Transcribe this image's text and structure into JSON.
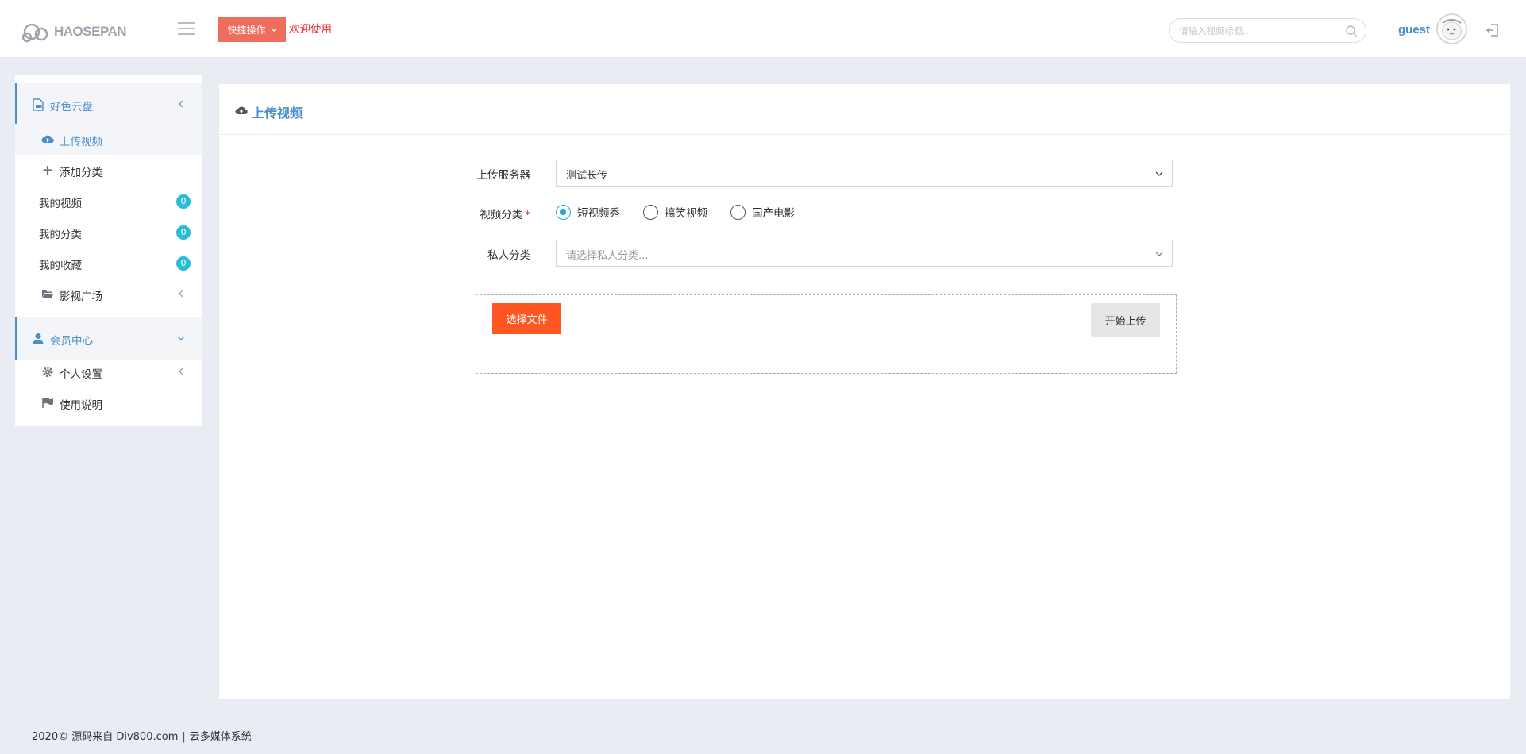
{
  "header": {
    "logo_text": "HAOSEPAN",
    "quick_action_label": "快捷操作",
    "welcome_text": "欢迎使用",
    "search_placeholder": "请输入视频标题...",
    "username": "guest"
  },
  "sidebar": {
    "group1": {
      "label": "好色云盘",
      "items": [
        {
          "label": "上传视频",
          "icon": "cloud-upload-icon"
        },
        {
          "label": "添加分类",
          "icon": "plus-icon"
        },
        {
          "label": "我的视频",
          "badge": "0"
        },
        {
          "label": "我的分类",
          "badge": "0"
        },
        {
          "label": "我的收藏",
          "badge": "0"
        },
        {
          "label": "影视广场",
          "icon": "folder-open-icon"
        }
      ]
    },
    "group2": {
      "label": "会员中心",
      "items": [
        {
          "label": "个人设置",
          "icon": "gear-icon"
        },
        {
          "label": "使用说明",
          "icon": "flag-icon"
        }
      ]
    }
  },
  "main": {
    "title": "上传视频",
    "form": {
      "server_label": "上传服务器",
      "server_value": "测试长传",
      "category_label": "视频分类",
      "category_required_mark": "*",
      "category_options": [
        "短视频秀",
        "搞笑视频",
        "国产电影"
      ],
      "category_selected": "短视频秀",
      "private_label": "私人分类",
      "private_placeholder": "请选择私人分类...",
      "pick_file_label": "选择文件",
      "start_upload_label": "开始上传"
    }
  },
  "footer": {
    "copyright": "2020© 源码来自 Div800.com",
    "divider": "|",
    "system": "云多媒体系统"
  },
  "colors": {
    "accent": "#4b8ec9",
    "quick_btn": "#ef6d5d",
    "welcome": "#e8313b",
    "badge": "#28bcd8",
    "pick_btn": "#ff5722",
    "radio_checked": "#28a7d8"
  }
}
